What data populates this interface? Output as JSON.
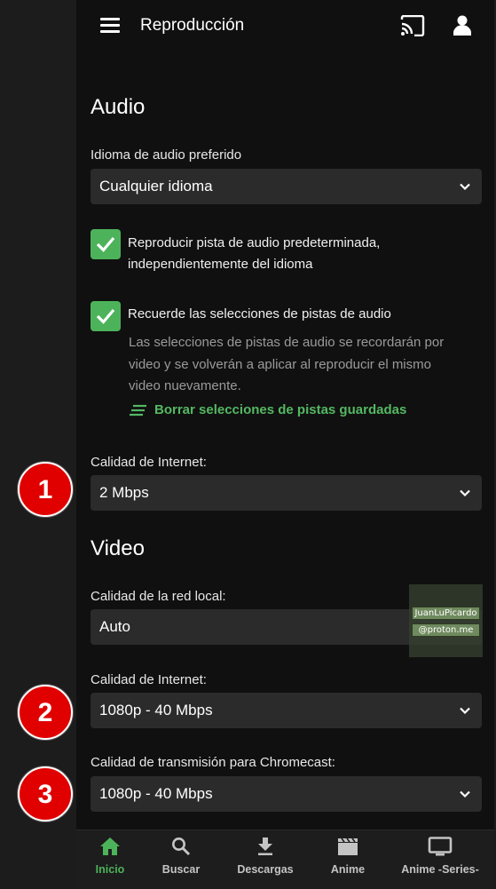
{
  "header": {
    "title": "Reproducción",
    "menu_icon": "menu-icon",
    "cast_icon": "cast-icon",
    "user_icon": "user-icon"
  },
  "audio": {
    "heading": "Audio",
    "preferred_language": {
      "label": "Idioma de audio preferido",
      "value": "Cualquier idioma"
    },
    "play_default": {
      "checked": true,
      "line1": "Reproducir pista de audio predeterminada,",
      "line2": "independientemente del idioma"
    },
    "remember": {
      "checked": true,
      "label": "Recuerde las selecciones de pistas de audio",
      "help1": "Las selecciones de pistas de audio se recordarán por",
      "help2": "video y se volverán a aplicar al reproducir el mismo",
      "help3": "video nuevamente.",
      "clear_link": "Borrar selecciones de pistas guardadas"
    },
    "internet_quality": {
      "label": "Calidad de Internet:",
      "value": "2 Mbps"
    }
  },
  "video": {
    "heading": "Video",
    "local_quality": {
      "label": "Calidad de la red local:",
      "value": "Auto"
    },
    "internet_quality": {
      "label": "Calidad de Internet:",
      "value": "1080p - 40 Mbps"
    },
    "chromecast_quality": {
      "label": "Calidad de transmisión para Chromecast:",
      "value": "1080p - 40 Mbps"
    }
  },
  "badges": [
    "1",
    "2",
    "3"
  ],
  "watermark": {
    "line1": "JuanLuPicardo",
    "line2": "@proton.me"
  },
  "nav": [
    {
      "label": "Inicio",
      "icon": "home-icon",
      "active": true
    },
    {
      "label": "Buscar",
      "icon": "search-icon"
    },
    {
      "label": "Descargas",
      "icon": "download-icon"
    },
    {
      "label": "Anime",
      "icon": "clapperboard-icon"
    },
    {
      "label": "Anime -Series-",
      "icon": "tv-icon"
    }
  ],
  "colors": {
    "accent": "#4cb35a",
    "badge": "#e00000",
    "background": "#101010",
    "field": "#2b2b2b"
  }
}
